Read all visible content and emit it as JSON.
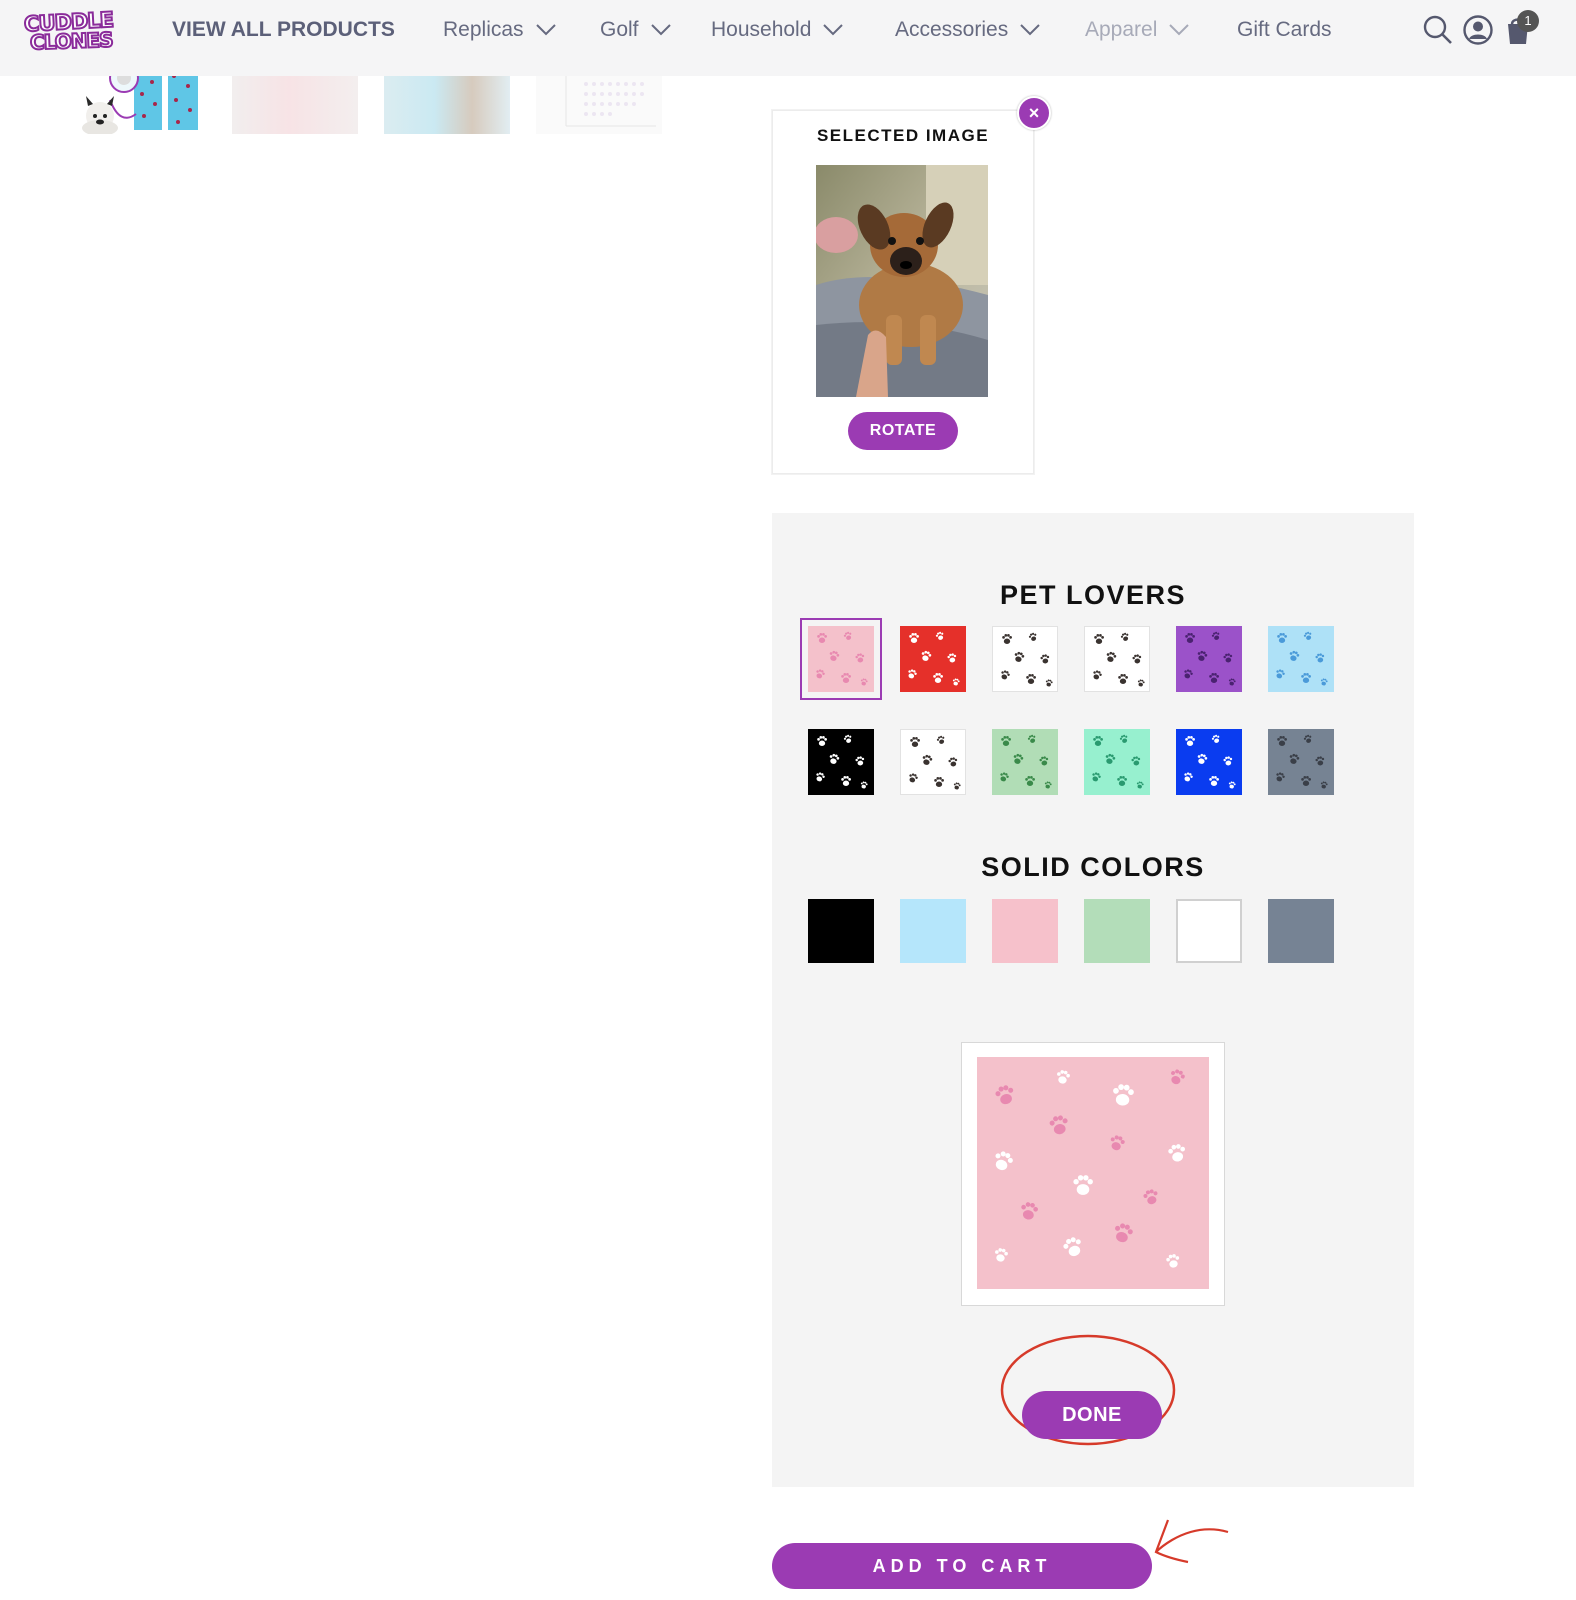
{
  "brand": {
    "logo_line1": "CUDDLE",
    "logo_line2": "CLONES",
    "accent": "#9b3bb3"
  },
  "nav": {
    "items": [
      {
        "label": "VIEW ALL PRODUCTS",
        "dropdown": false
      },
      {
        "label": "Replicas",
        "dropdown": true
      },
      {
        "label": "Golf",
        "dropdown": true
      },
      {
        "label": "Household",
        "dropdown": true
      },
      {
        "label": "Accessories",
        "dropdown": true
      },
      {
        "label": "Apparel",
        "dropdown": true
      },
      {
        "label": "Gift Cards",
        "dropdown": false
      }
    ],
    "cart_count": "1",
    "icons": [
      "search-icon",
      "account-icon",
      "cart-icon"
    ]
  },
  "selected_image": {
    "title": "SELECTED IMAGE",
    "rotate_label": "ROTATE",
    "close_icon": "close-icon"
  },
  "patterns": {
    "pet_lovers_title": "PET LOVERS",
    "pet_lovers": [
      {
        "bg": "#f4c1cb",
        "fg": "#e889b0",
        "selected": true
      },
      {
        "bg": "#e5302a",
        "fg": "#ffffff",
        "selected": false
      },
      {
        "bg": "#ffffff",
        "fg": "#3a3330",
        "selected": false
      },
      {
        "bg": "#ffffff",
        "fg": "#3a3330",
        "selected": false
      },
      {
        "bg": "#9b52c9",
        "fg": "#4a2270",
        "selected": false
      },
      {
        "bg": "#aee1f7",
        "fg": "#4a9ad9",
        "selected": false
      },
      {
        "bg": "#000000",
        "fg": "#ffffff",
        "selected": false
      },
      {
        "bg": "#ffffff",
        "fg": "#3a3330",
        "selected": false
      },
      {
        "bg": "#b1ddb6",
        "fg": "#3a8a4a",
        "selected": false
      },
      {
        "bg": "#97f0cf",
        "fg": "#2a9a70",
        "selected": false
      },
      {
        "bg": "#0a3cf0",
        "fg": "#ffffff",
        "selected": false
      },
      {
        "bg": "#768393",
        "fg": "#3a3f48",
        "selected": false
      }
    ],
    "solid_title": "SOLID COLORS",
    "solids": [
      "#000000",
      "#b5e6fb",
      "#f6c1cb",
      "#b3ddb9",
      "#ffffff",
      "#768394"
    ],
    "preview_bg": "#f4c1cb"
  },
  "buttons": {
    "done_label": "DONE",
    "add_to_cart_label": "ADD TO CART"
  }
}
